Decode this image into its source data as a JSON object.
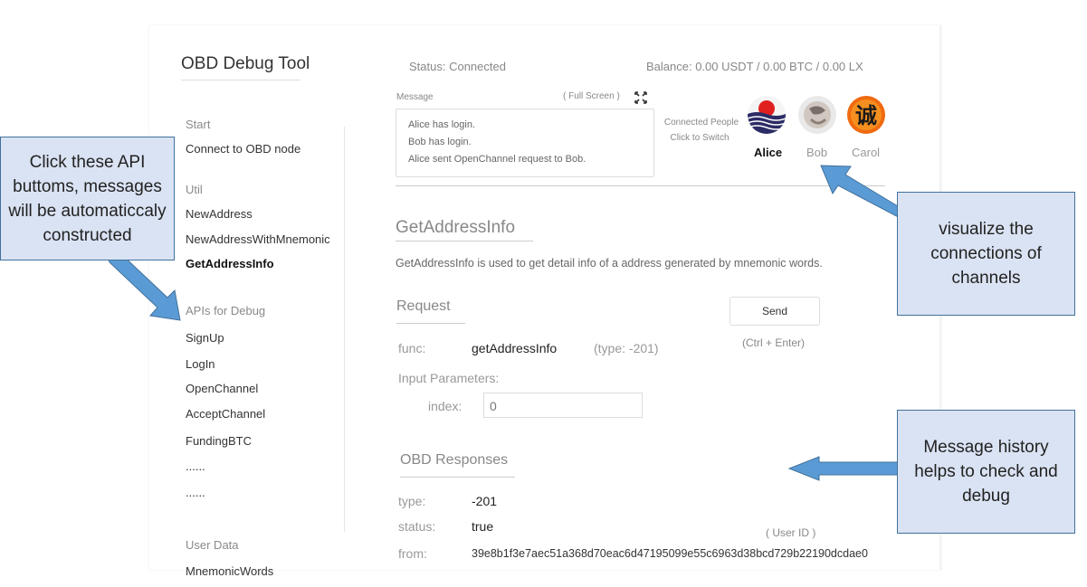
{
  "app": {
    "title": "OBD Debug Tool"
  },
  "sidebar": {
    "sections": [
      {
        "title": "Start",
        "items": [
          {
            "label": "Connect to OBD node"
          }
        ]
      },
      {
        "title": "Util",
        "items": [
          {
            "label": "NewAddress"
          },
          {
            "label": "NewAddressWithMnemonic"
          },
          {
            "label": "GetAddressInfo",
            "active": true
          }
        ]
      },
      {
        "title": "APIs for Debug",
        "items": [
          {
            "label": "SignUp"
          },
          {
            "label": "LogIn"
          },
          {
            "label": "OpenChannel"
          },
          {
            "label": "AcceptChannel"
          },
          {
            "label": "FundingBTC"
          },
          {
            "label": "......"
          },
          {
            "label": "......"
          }
        ]
      },
      {
        "title": "User Data",
        "items": [
          {
            "label": "MnemonicWords"
          }
        ]
      }
    ]
  },
  "header": {
    "status": "Status:  Connected",
    "balance": "Balance:  0.00 USDT  /  0.00 BTC  /  0.00 LX"
  },
  "message": {
    "label": "Message",
    "fullscreen": "( Full Screen )",
    "lines": [
      "Alice has login.",
      "Bob has login.",
      "Alice sent OpenChannel request to Bob."
    ]
  },
  "people": {
    "caption1": "Connected People",
    "caption2": "Click to Switch",
    "list": [
      {
        "name": "Alice",
        "active": true
      },
      {
        "name": "Bob"
      },
      {
        "name": "Carol"
      }
    ]
  },
  "main": {
    "title": "GetAddressInfo",
    "description": "GetAddressInfo is used to get detail info of a address generated by mnemonic words.",
    "request_title": "Request",
    "send_label": "Send",
    "send_hint": "(Ctrl + Enter)",
    "func_label": "func:",
    "func_value": "getAddressInfo",
    "func_type": "(type: -201)",
    "params_label": "Input Parameters:",
    "index_label": "index:",
    "index_value": "0"
  },
  "responses": {
    "title": "OBD Responses",
    "type_label": "type:",
    "type_value": "-201",
    "status_label": "status:",
    "status_value": "true",
    "from_label": "from:",
    "from_value": "39e8b1f3e7aec51a368d70eac6d47195099e55c6963d38bcd729b22190dcdae0",
    "user_id_note": "( User ID )"
  },
  "callouts": {
    "api": "Click these API buttoms, messages will be automaticcaly constructed",
    "connections": "visualize the connections of channels",
    "history": "Message history helps to check and debug"
  },
  "colors": {
    "callout_fill": "#dae3f3",
    "callout_border": "#41719c",
    "arrow": "#5b9bd5"
  }
}
